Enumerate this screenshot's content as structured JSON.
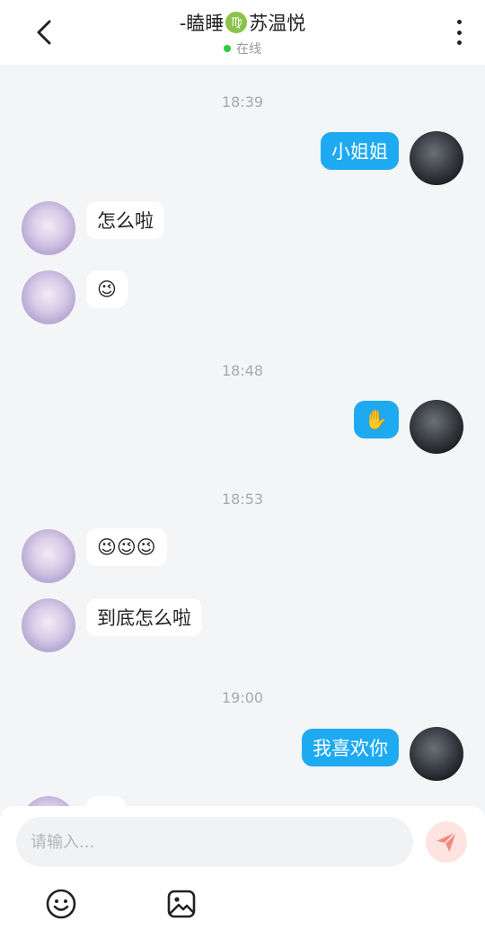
{
  "header": {
    "name_prefix": "-瞌睡",
    "zodiac_symbol": "♍",
    "name_suffix": "苏温悦",
    "status": "在线",
    "status_color": "#2ecc40"
  },
  "messages": [
    {
      "time": "18:39"
    },
    {
      "side": "right",
      "text": "小姐姐"
    },
    {
      "side": "left",
      "text": "怎么啦"
    },
    {
      "side": "left",
      "text": "😉"
    },
    {
      "time": "18:48"
    },
    {
      "side": "right",
      "text": "✋"
    },
    {
      "time": "18:53"
    },
    {
      "side": "left",
      "text": "😉😉😉"
    },
    {
      "side": "left",
      "text": "到底怎么啦"
    },
    {
      "time": "19:00"
    },
    {
      "side": "right",
      "text": "我喜欢你"
    }
  ],
  "input": {
    "placeholder": "请输入..."
  },
  "toolbar": {
    "emoji_icon": "emoji-icon",
    "image_icon": "image-icon",
    "send_icon": "send-icon"
  },
  "colors": {
    "accent": "#1eaaf1",
    "background": "#f4f5f7",
    "send_button_bg": "#fde4e1",
    "send_icon": "#f2897a"
  }
}
